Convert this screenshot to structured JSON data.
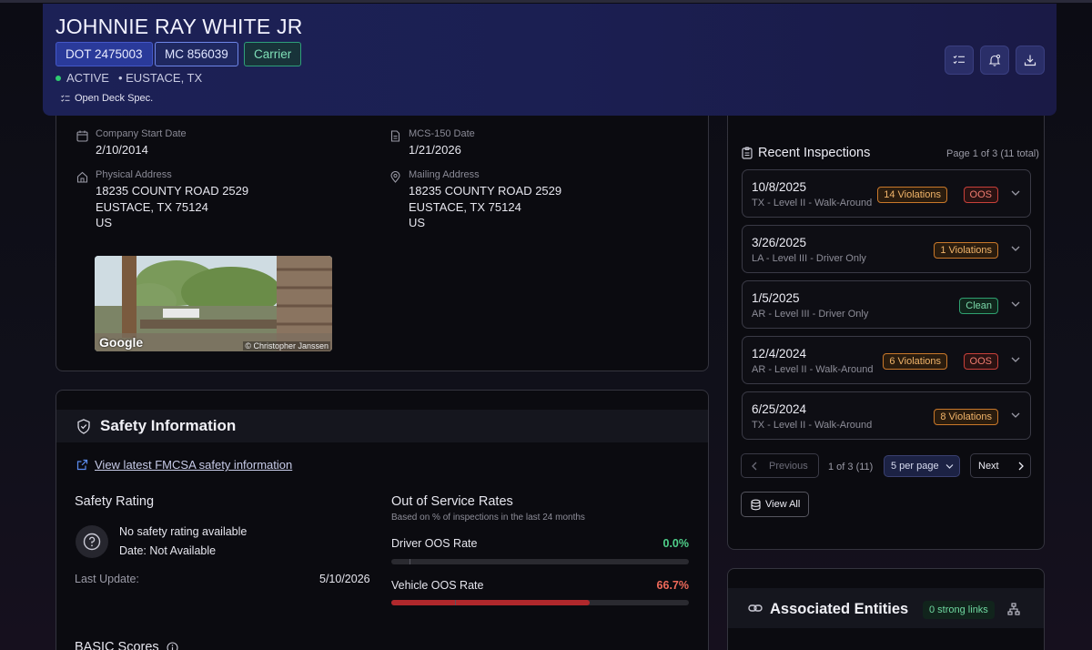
{
  "header": {
    "name": "JOHNNIE RAY WHITE JR",
    "dot": "DOT 2475003",
    "mc": "MC 856039",
    "type": "Carrier",
    "status": "ACTIVE",
    "location": "• EUSTACE, TX",
    "spec": "Open Deck Spec."
  },
  "company": {
    "start_label": "Company Start Date",
    "start_value": "2/10/2014",
    "mcs_label": "MCS-150 Date",
    "mcs_value": "1/21/2026",
    "physical_label": "Physical Address",
    "physical_line1": "18235 COUNTY ROAD 2529",
    "physical_line2": "EUSTACE,  TX 75124",
    "physical_line3": "US",
    "mailing_label": "Mailing Address",
    "mailing_line1": "18235 COUNTY ROAD 2529",
    "mailing_line2": "EUSTACE,  TX 75124",
    "mailing_line3": "US",
    "streetview_brand": "Google",
    "streetview_credit": "© Christopher Janssen"
  },
  "safety": {
    "title": "Safety Information",
    "link": "View latest FMCSA safety information",
    "rating_title": "Safety Rating",
    "rating_text": "No safety rating available",
    "rating_date": "Date: Not Available",
    "last_update_label": "Last Update:",
    "last_update_value": "5/10/2026",
    "oos_title": "Out of Service Rates",
    "oos_sub": "Based on % of inspections in the last 24 months",
    "driver_label": "Driver OOS Rate",
    "driver_value": "0.0%",
    "driver_fraction": 0.0,
    "vehicle_label": "Vehicle OOS Rate",
    "vehicle_value": "66.7%",
    "vehicle_fraction": 0.667,
    "basic_title": "BASIC Scores"
  },
  "inspections": {
    "title": "Recent Inspections",
    "page_info": "Page 1 of 3 (11 total)",
    "items": [
      {
        "date": "10/8/2025",
        "sub": "TX - Level II - Walk-Around",
        "badge": "14 Violations",
        "oos": "OOS"
      },
      {
        "date": "3/26/2025",
        "sub": "LA - Level III - Driver Only",
        "badge": "1 Violations",
        "oos": ""
      },
      {
        "date": "1/5/2025",
        "sub": "AR - Level III - Driver Only",
        "badge": "Clean",
        "oos": ""
      },
      {
        "date": "12/4/2024",
        "sub": "AR - Level II - Walk-Around",
        "badge": "6 Violations",
        "oos": "OOS"
      },
      {
        "date": "6/25/2024",
        "sub": "TX - Level II - Walk-Around",
        "badge": "8 Violations",
        "oos": ""
      }
    ],
    "previous": "Previous",
    "page_count": "1 of 3 (11)",
    "per_page": "5 per page",
    "next": "Next",
    "view_all": "View All"
  },
  "associated": {
    "title": "Associated Entities",
    "badge": "0 strong links"
  },
  "colors": {
    "accent": "#1c2156",
    "oos_red": "#b0282c",
    "green": "#2ecc71"
  }
}
